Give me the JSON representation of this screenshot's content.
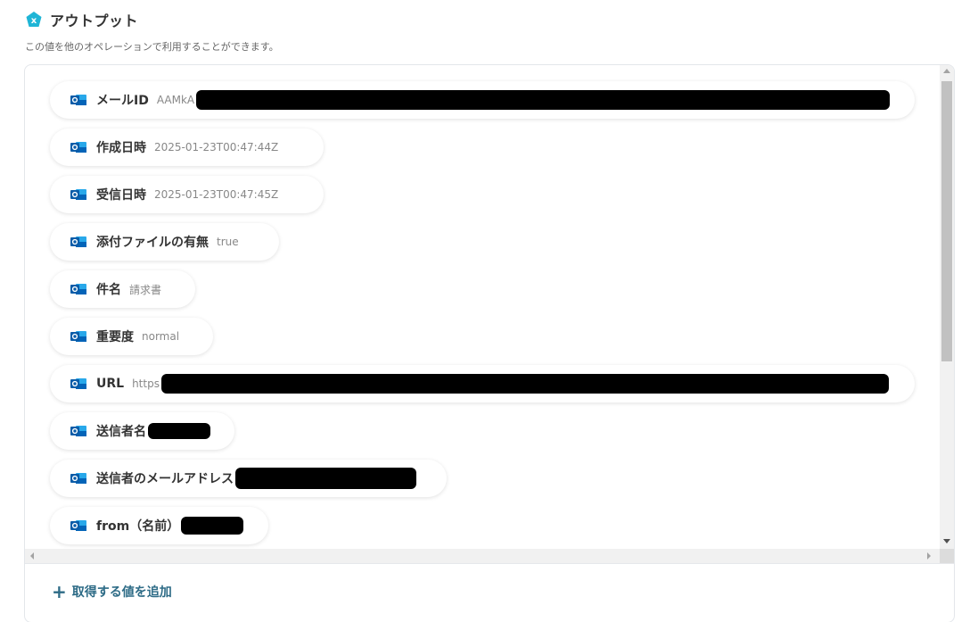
{
  "header": {
    "title": "アウトプット",
    "subtitle": "この値を他のオペレーションで利用することができます。",
    "icon": "variable-icon",
    "accent_color": "#1fb5d6"
  },
  "outputs": [
    {
      "label": "メールID",
      "value": "AAMkA",
      "redacted": true
    },
    {
      "label": "作成日時",
      "value": "2025-01-23T00:47:44Z"
    },
    {
      "label": "受信日時",
      "value": "2025-01-23T00:47:45Z"
    },
    {
      "label": "添付ファイルの有無",
      "value": "true"
    },
    {
      "label": "件名",
      "value": "請求書"
    },
    {
      "label": "重要度",
      "value": "normal"
    },
    {
      "label": "URL",
      "value": "https",
      "redacted": true
    },
    {
      "label": "送信者名",
      "value": "",
      "redacted": true
    },
    {
      "label": "送信者のメールアドレス",
      "value": "",
      "redacted": true
    },
    {
      "label": "from（名前）",
      "value": "",
      "redacted": true
    }
  ],
  "footer": {
    "add_label": "取得する値を追加",
    "add_icon": "plus-icon",
    "link_color": "#2d6b86"
  },
  "item_icon": "outlook-icon"
}
